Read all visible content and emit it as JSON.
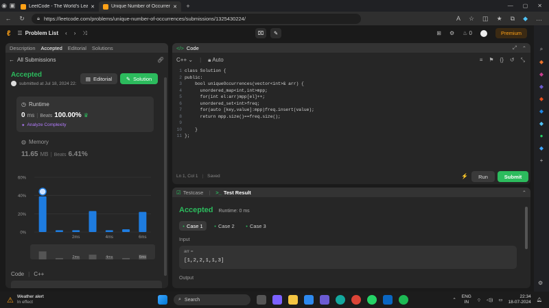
{
  "browser": {
    "tabs": [
      {
        "title": "LeetCode - The World's Leading",
        "active": false
      },
      {
        "title": "Unique Number of Occurrences",
        "active": true
      }
    ],
    "url": "https://leetcode.com/problems/unique-number-of-occurrences/submissions/1325430224/"
  },
  "header": {
    "problem_list": "Problem List",
    "streak": "0",
    "premium": "Premium"
  },
  "left_panel": {
    "tabs": [
      "Description",
      "Accepted",
      "Editorial",
      "Solutions"
    ],
    "all_submissions": "All Submissions",
    "status": "Accepted",
    "submitted": "submitted at Jul 18, 2024 22:",
    "editorial_btn": "Editorial",
    "solution_btn": "Solution",
    "runtime_label": "Runtime",
    "runtime_value": "0",
    "runtime_unit": "ms",
    "beats_label": "Beats",
    "runtime_beats": "100.00%",
    "analyze": "Analyze Complexity",
    "memory_label": "Memory",
    "memory_value": "11.65",
    "memory_unit": "MB",
    "memory_beats": "6.41%",
    "code_label": "Code",
    "code_lang": "C++"
  },
  "chart_data": {
    "type": "bar",
    "ylim": [
      0,
      60
    ],
    "yticks": [
      "60%",
      "40%",
      "20%",
      "0%"
    ],
    "xticks": [
      "2ms",
      "4ms",
      "6ms"
    ],
    "categories": [
      "0ms",
      "1ms",
      "2ms",
      "3ms",
      "4ms",
      "5ms",
      "6ms"
    ],
    "values": [
      39,
      2,
      2,
      23,
      2,
      3,
      22
    ],
    "highlight_index": 0
  },
  "editor": {
    "title": "Code",
    "language": "C++",
    "mode": "Auto",
    "line_numbers": [
      "1",
      "2",
      "3",
      "4",
      "5",
      "6",
      "7",
      "8",
      "9",
      "10",
      "11"
    ],
    "lines": [
      "class Solution {",
      "public:",
      "    bool uniqueOccurrences(vector<int>& arr) {",
      "      unordered_map<int,int>mpp;",
      "      for(int el:arr)mpp[el]++;",
      "      unordered_set<int>freq;",
      "      for(auto [key,value]:mpp)freq.insert(value);",
      "      return mpp.size()==freq.size();",
      "",
      "    }",
      "};"
    ],
    "status": "Ln 1, Col 1",
    "saved": "Saved",
    "run": "Run",
    "submit": "Submit"
  },
  "result": {
    "testcase_tab": "Testcase",
    "result_tab": "Test Result",
    "status": "Accepted",
    "runtime": "Runtime: 0 ms",
    "cases": [
      "Case 1",
      "Case 2",
      "Case 3"
    ],
    "input_label": "Input",
    "arr_label": "arr =",
    "arr_value": "[1,2,2,1,1,3]",
    "output_label": "Output"
  },
  "taskbar": {
    "weather_title": "Weather alert",
    "weather_sub": "In effect",
    "search": "Search",
    "lang1": "ENG",
    "lang2": "IN",
    "time": "22:34",
    "date": "18-07-2024"
  },
  "colors": {
    "accent_green": "#2cbb5d",
    "premium": "#ffa116",
    "bar": "#1e7ce0"
  }
}
